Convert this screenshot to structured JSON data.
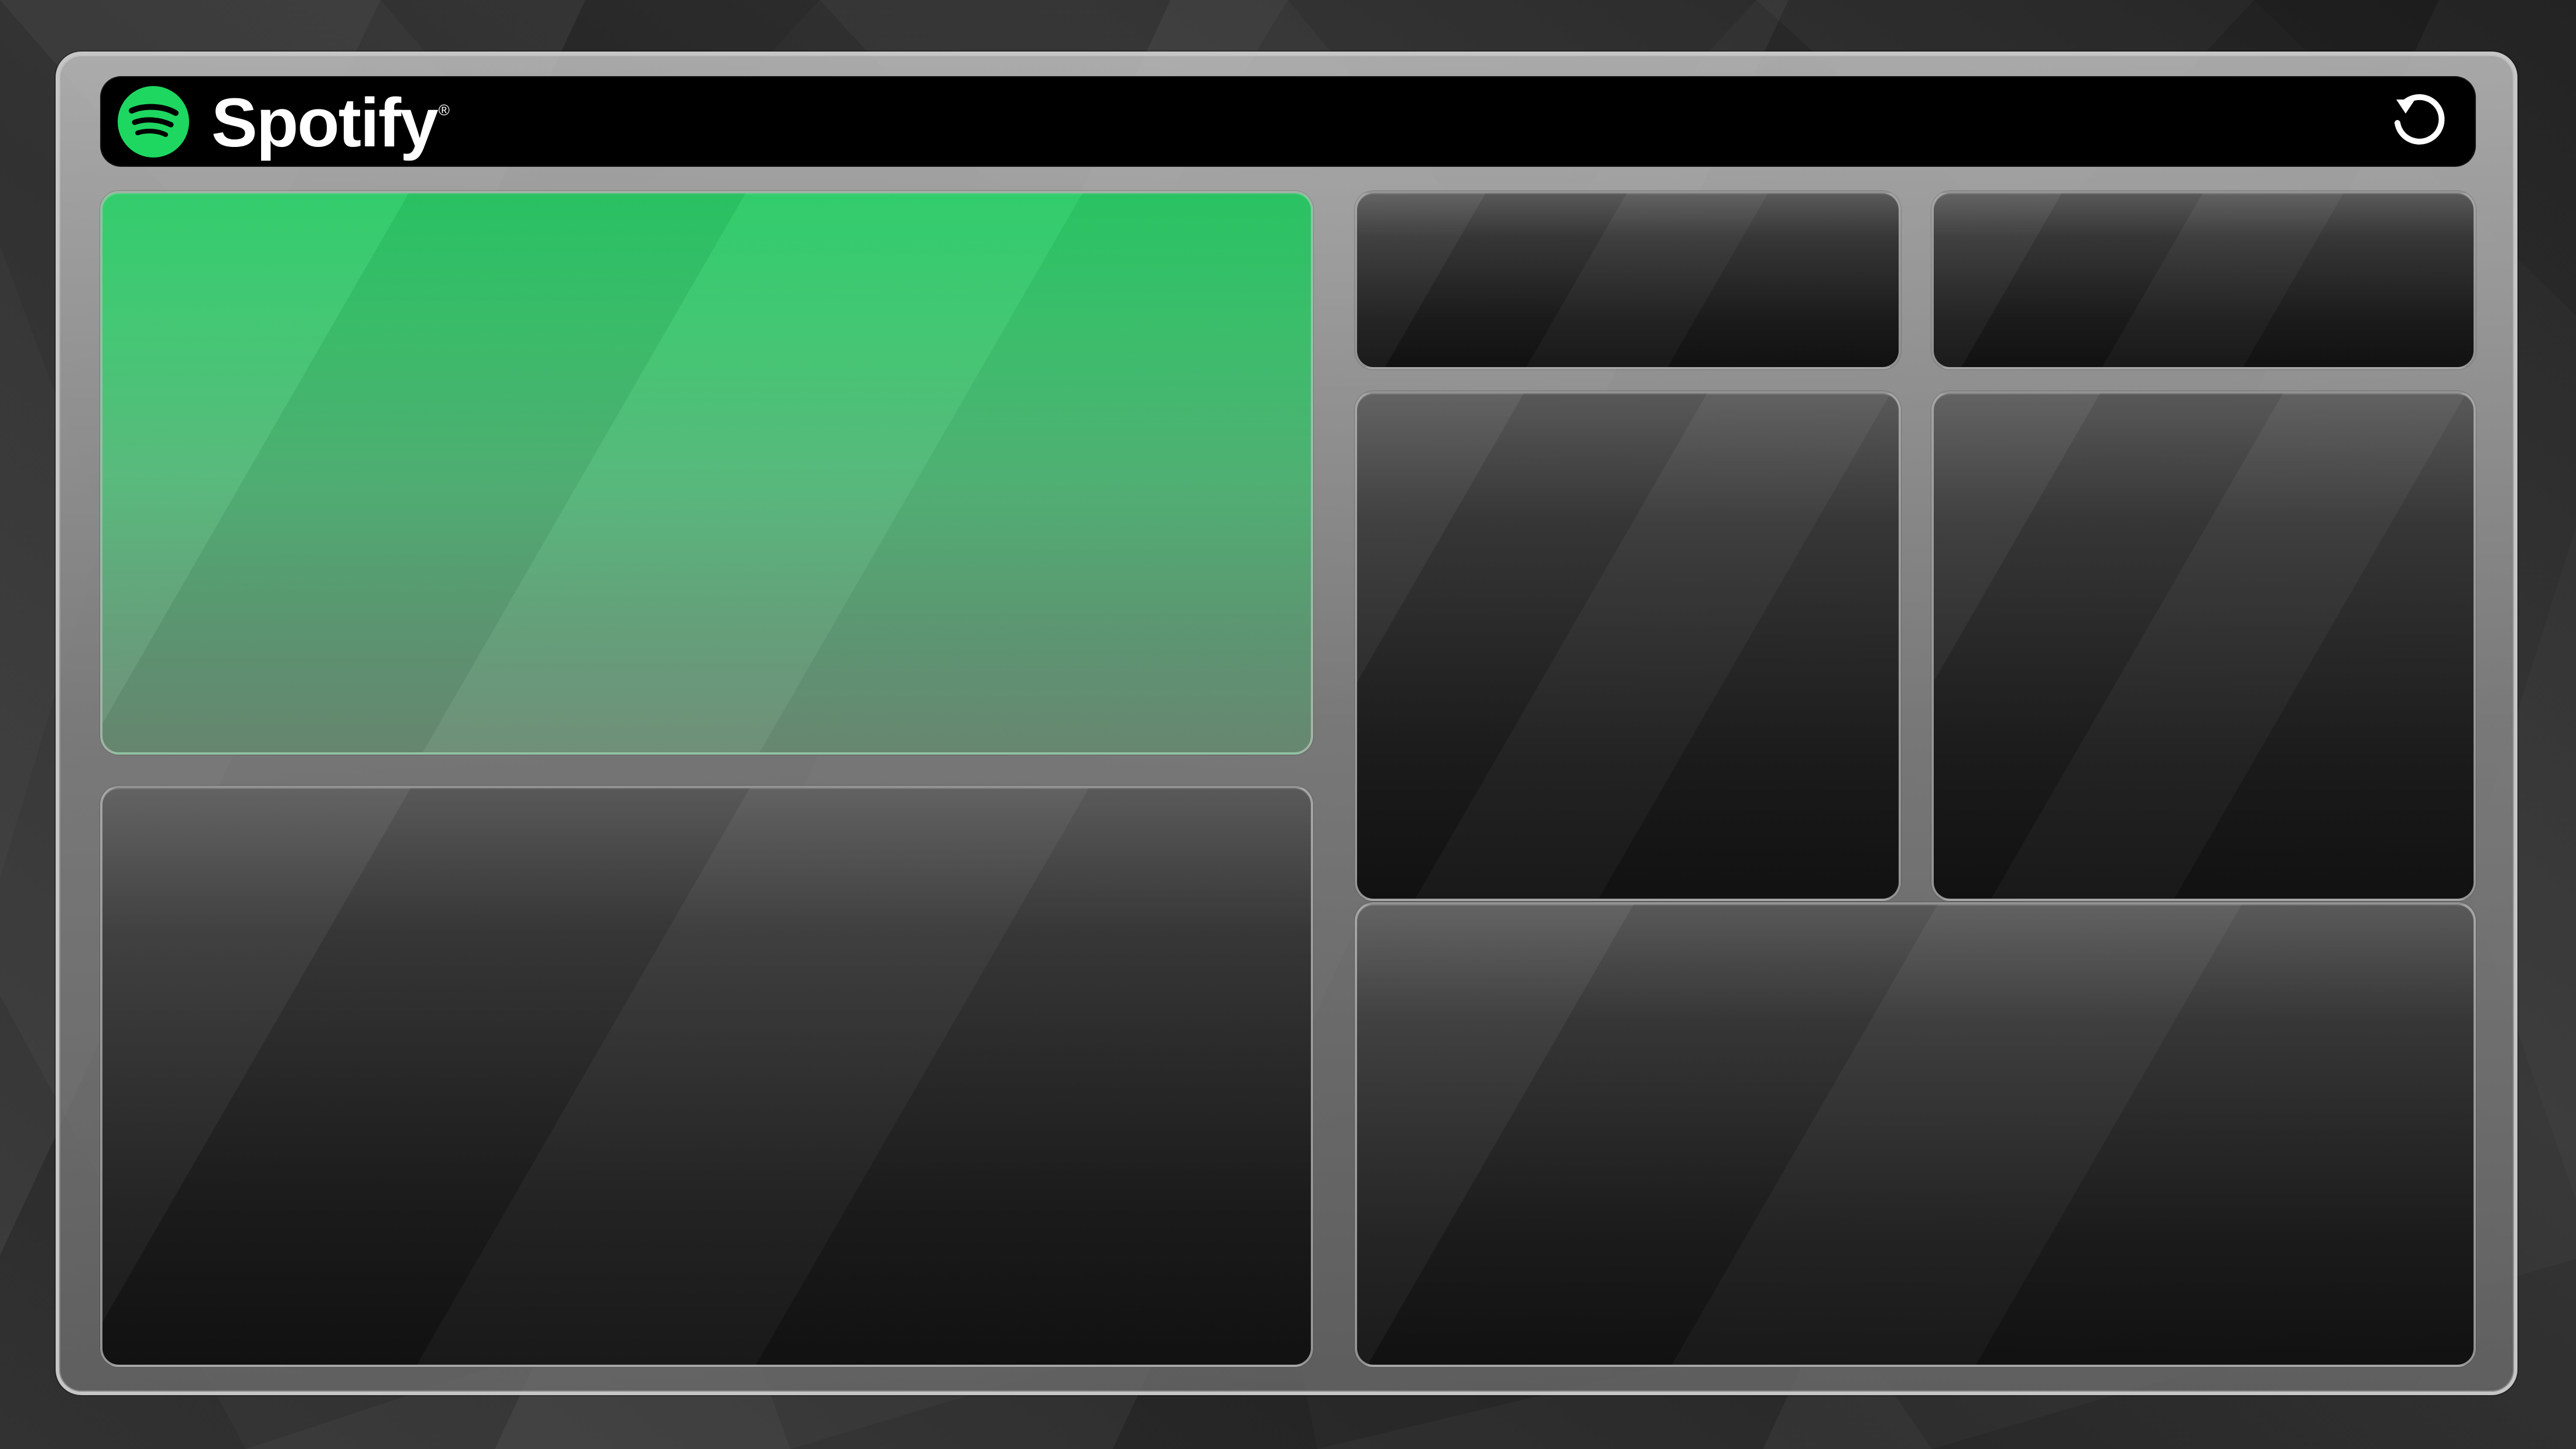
{
  "app": {
    "brand_name": "Spotify",
    "brand_trademark": "®",
    "brand_color": "#1ED760",
    "accent_panel_color": "#2BCB67"
  },
  "header": {
    "logo_icon": "spotify-logo-icon",
    "refresh_icon": "refresh-icon"
  },
  "panels": [
    {
      "id": "featured",
      "state": "highlighted"
    },
    {
      "id": "bottom-left",
      "state": "empty"
    },
    {
      "id": "top-right-small-1",
      "state": "empty"
    },
    {
      "id": "top-right-small-2",
      "state": "empty"
    },
    {
      "id": "right-middle-1",
      "state": "empty"
    },
    {
      "id": "right-middle-2",
      "state": "empty"
    },
    {
      "id": "bottom-right",
      "state": "empty"
    }
  ]
}
